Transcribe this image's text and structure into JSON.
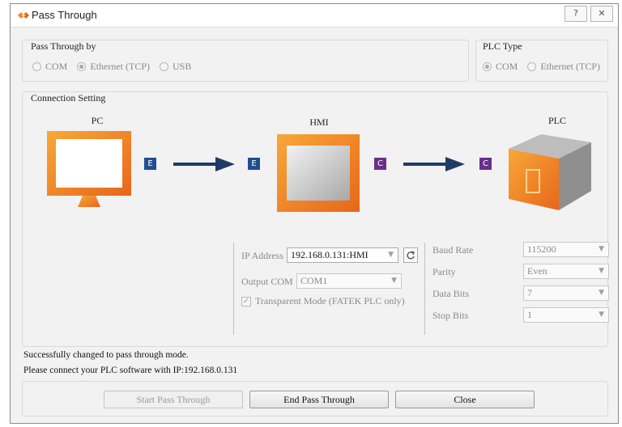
{
  "window": {
    "title": "Pass Through",
    "help_glyph": "?",
    "close_glyph": "✕"
  },
  "pass_through_by": {
    "title": "Pass Through by",
    "options": [
      {
        "label": "COM",
        "selected": false
      },
      {
        "label": "Ethernet (TCP)",
        "selected": true
      },
      {
        "label": "USB",
        "selected": false
      }
    ]
  },
  "plc_type": {
    "title": "PLC Type",
    "options": [
      {
        "label": "COM",
        "selected": true
      },
      {
        "label": "Ethernet (TCP)",
        "selected": false
      }
    ]
  },
  "connection": {
    "title": "Connection Setting",
    "pc_label": "PC",
    "hmi_label": "HMI",
    "plc_label": "PLC",
    "badge_e": "E",
    "badge_c": "C",
    "ip_address_label": "IP Address",
    "ip_address_value": "192.168.0.131:HMI",
    "output_com_label": "Output COM",
    "output_com_value": "COM1",
    "transparent_mode_label": "Transparent Mode (FATEK PLC only)",
    "transparent_mode_checked": true,
    "baud_rate_label": "Baud Rate",
    "baud_rate_value": "115200",
    "parity_label": "Parity",
    "parity_value": "Even",
    "data_bits_label": "Data Bits",
    "data_bits_value": "7",
    "stop_bits_label": "Stop Bits",
    "stop_bits_value": "1"
  },
  "status": {
    "line1": "Successfully changed to pass through mode.",
    "line2": "Please connect your PLC software with IP:192.168.0.131"
  },
  "buttons": {
    "start": "Start Pass Through",
    "end": "End Pass Through",
    "close": "Close"
  },
  "colors": {
    "orange": "#f08a1c",
    "e_badge": "#1f4f8f",
    "c_badge": "#6a2f8a",
    "arrow": "#1f3a66"
  }
}
